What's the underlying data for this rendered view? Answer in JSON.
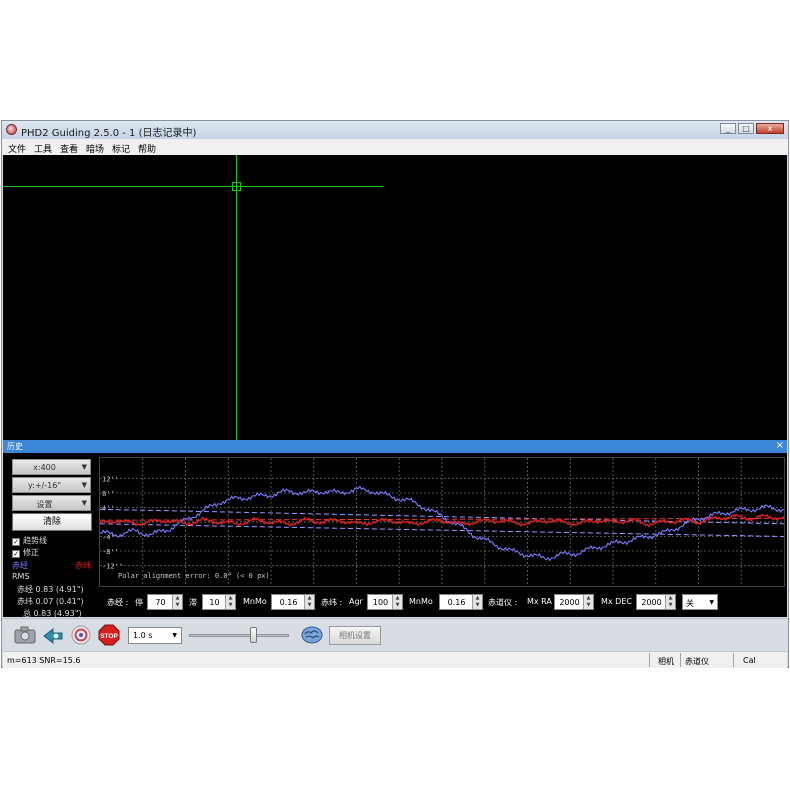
{
  "window": {
    "title": "PHD2 Guiding 2.5.0 - 1 (日志记录中)",
    "controls": {
      "minimize": "_",
      "maximize": "□",
      "close": "x"
    }
  },
  "menu": [
    "文件",
    "工具",
    "查看",
    "暗场",
    "标记",
    "帮助"
  ],
  "history_panel": {
    "title": "历史",
    "close": "×",
    "x_scale": "x:400",
    "y_scale": "y:+/-16\"",
    "settings": "设置",
    "clear": "清除",
    "trendlines": "趋势线",
    "corrections": "修正",
    "ra_label": "赤经",
    "dec_label": "赤纬",
    "rms_title": "RMS",
    "rms_ra": "赤经 0.83 (4.91\")",
    "rms_dec": "赤纬 0.07 (0.41\")",
    "rms_total": "总 0.83 (4.93\")",
    "polar_text": "Polar alignment error: 0.0°  (< 0 px)",
    "colors": {
      "ra": "#7b7bff",
      "dec": "#e02020"
    }
  },
  "chart_data": {
    "type": "line",
    "y_ticks": [
      "12''",
      "8''",
      "4''",
      "-4''",
      "-8''",
      "-12''"
    ],
    "ylim": [
      -16,
      16
    ],
    "xlim": [
      0,
      400
    ],
    "grid": true,
    "x": [
      0,
      10,
      20,
      30,
      40,
      50,
      60,
      70,
      80,
      90,
      100,
      110,
      120,
      130,
      140,
      150,
      160,
      170,
      180,
      190,
      200,
      210,
      220,
      230,
      240,
      250,
      260,
      270,
      280,
      290,
      300,
      310,
      320,
      330,
      340,
      350,
      360,
      370,
      380,
      390,
      400
    ],
    "series": [
      {
        "color": "#7b7bff",
        "values": [
          -3,
          -3.5,
          -2.5,
          -3.5,
          -2,
          0.5,
          3,
          5.5,
          6.5,
          7,
          7.5,
          8.5,
          8,
          8.5,
          8,
          9,
          8.5,
          7,
          6,
          4,
          1.5,
          -1,
          -4,
          -6,
          -8,
          -9,
          -10,
          -9,
          -8.5,
          -7,
          -6,
          -5,
          -4,
          -3,
          -1,
          1,
          2,
          3,
          3.5,
          4,
          3.5
        ]
      },
      {
        "color": "#e02020",
        "values": [
          -0.5,
          0.5,
          -0.5,
          0,
          0.5,
          -0.5,
          0.5,
          0,
          -0.5,
          0.5,
          0,
          -0.5,
          0.5,
          0,
          0.5,
          -0.5,
          0,
          0.5,
          -0.5,
          0,
          0.5,
          -0.5,
          0,
          0.5,
          0,
          -0.5,
          0.5,
          0,
          -0.5,
          0.5,
          0,
          0.5,
          -0.5,
          0,
          0.5,
          0,
          1,
          1.5,
          1,
          1.5,
          1
        ]
      }
    ],
    "trend_lines": [
      {
        "color": "#9a9aff",
        "from": [
          0,
          3.5
        ],
        "to": [
          400,
          -0.5
        ]
      },
      {
        "color": "#9a9aff",
        "from": [
          0,
          -0.5
        ],
        "to": [
          400,
          -4
        ]
      },
      {
        "color": "#d84040",
        "from": [
          0,
          0.5
        ],
        "to": [
          400,
          1
        ]
      }
    ]
  },
  "controls": {
    "ra": {
      "label": "赤经 :",
      "hyst_label": "停",
      "hyst": "70",
      "agg_label": "滞",
      "agg": "10",
      "minmo_label": "MnMo",
      "minmo": "0.16"
    },
    "dec": {
      "label": "赤纬 :",
      "agr_label": "Agr",
      "agr": "100",
      "minmo_label": "MnMo",
      "minmo": "0.16"
    },
    "mount": {
      "label": "赤道仪 :",
      "mxra_label": "Mx RA",
      "mxra": "2000",
      "mxdec_label": "Mx DEC",
      "mxdec": "2000",
      "mode": "关"
    }
  },
  "toolbar": {
    "exposure": "1.0 s",
    "camera_settings": "相机设置",
    "stop_label": "STOP",
    "icons": [
      "camera-icon",
      "loop-icon",
      "guide-target-icon",
      "stop-icon",
      "brain-icon"
    ]
  },
  "statusbar": {
    "left": "m=613 SNR=15.6",
    "camera": "相机",
    "mount": "赤道仪",
    "cal": "Cal"
  }
}
